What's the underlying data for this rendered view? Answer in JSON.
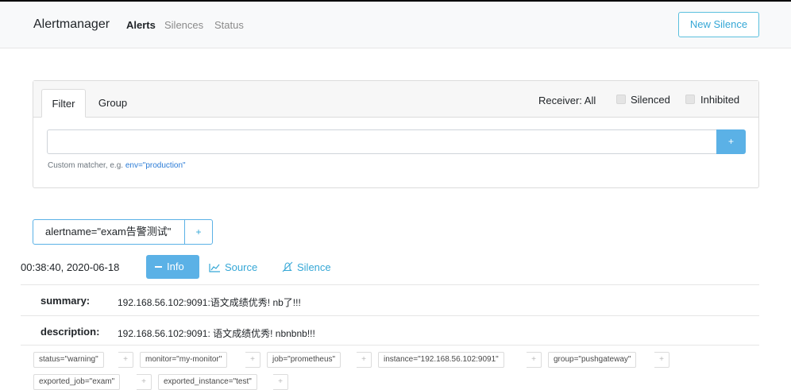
{
  "navbar": {
    "brand": "Alertmanager",
    "links": [
      "Alerts",
      "Silences",
      "Status"
    ],
    "new_silence": "New Silence"
  },
  "filter": {
    "tabs": [
      "Filter",
      "Group"
    ],
    "receiver": "Receiver: All",
    "silenced_label": "Silenced",
    "inhibited_label": "Inhibited",
    "input_value": "",
    "add_label": "+",
    "hint_prefix": "Custom matcher, e.g.",
    "hint_example": "env=\"production\""
  },
  "group": {
    "label": "alertname=\"exam告警测试\"",
    "add_label": "+"
  },
  "alert": {
    "time": "00:38:40, 2020-06-18",
    "info_label": "Info",
    "source_label": "Source",
    "silence_label": "Silence",
    "annotations": [
      {
        "key": "summary:",
        "value": "192.168.56.102:9091:语文成绩优秀! nb了!!!"
      },
      {
        "key": "description:",
        "value": "192.168.56.102:9091: 语文成绩优秀! nbnbnb!!!"
      }
    ],
    "labels": [
      "status=\"warning\"",
      "monitor=\"my-monitor\"",
      "job=\"prometheus\"",
      "instance=\"192.168.56.102:9091\"",
      "group=\"pushgateway\"",
      "exported_job=\"exam\"",
      "exported_instance=\"test\""
    ],
    "label_add": "+"
  },
  "colors": {
    "accent": "#5bb1e6",
    "link": "#35a7d6"
  }
}
